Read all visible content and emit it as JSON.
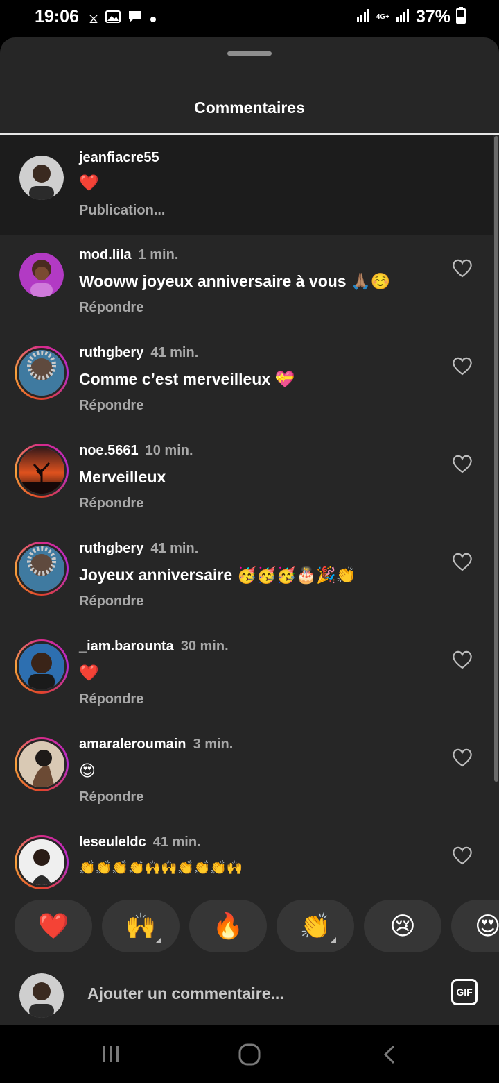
{
  "status": {
    "time": "19:06",
    "network": "4G+",
    "battery": "37%"
  },
  "sheet": {
    "title": "Commentaires"
  },
  "caption": {
    "username": "jeanfiacre55",
    "text": "❤️",
    "meta": "Publication..."
  },
  "comments": [
    {
      "username": "mod.lila",
      "time": "1 min.",
      "text": "Wooww joyeux anniversaire à vous 🙏🏽☺️",
      "reply": "Répondre"
    },
    {
      "username": "ruthgbery",
      "time": "41 min.",
      "text": "Comme c’est merveilleux 💝",
      "reply": "Répondre"
    },
    {
      "username": "noe.5661",
      "time": "10 min.",
      "text": "Merveilleux",
      "reply": "Répondre"
    },
    {
      "username": "ruthgbery",
      "time": "41 min.",
      "text": "Joyeux anniversaire 🥳🥳🥳🎂🎉👏",
      "reply": "Répondre"
    },
    {
      "username": "_iam.barounta",
      "time": "30 min.",
      "text": "❤️",
      "reply": "Répondre"
    },
    {
      "username": "amaraleroumain",
      "time": "3 min.",
      "text": "😍",
      "reply": "Répondre"
    },
    {
      "username": "leseuleldc",
      "time": "41 min.",
      "text": "👏👏👏👏🙌🙌👏👏👏🙌",
      "reply": ""
    }
  ],
  "reactions": [
    "❤️",
    "🙌",
    "🔥",
    "👏",
    "😢",
    "😍"
  ],
  "input": {
    "placeholder": "Ajouter un commentaire...",
    "gif_label": "GIF"
  },
  "icons": {
    "like": "heart-outline-icon",
    "nav": [
      "recents-icon",
      "home-icon",
      "back-icon"
    ]
  }
}
